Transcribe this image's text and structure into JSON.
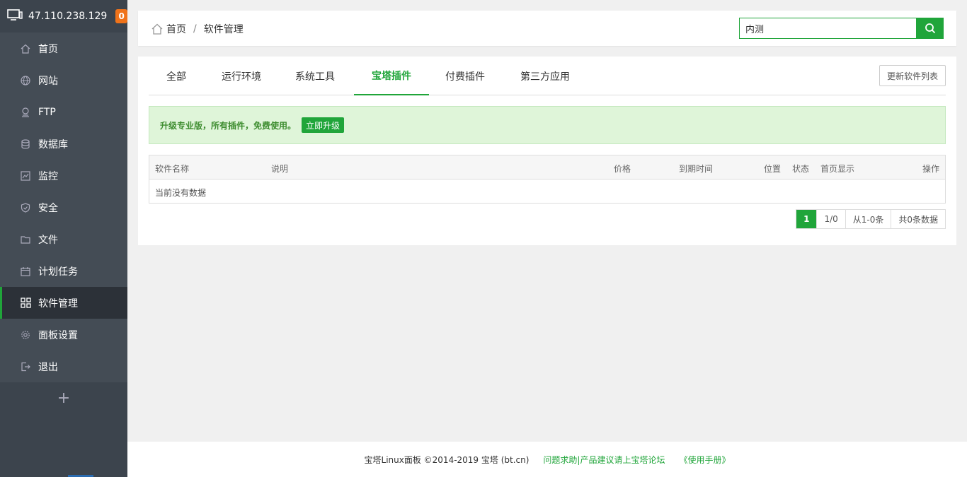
{
  "sidebar": {
    "ip": "47.110.238.129",
    "badge": "0",
    "items": [
      {
        "label": "首页",
        "icon": "home-icon"
      },
      {
        "label": "网站",
        "icon": "globe-icon"
      },
      {
        "label": "FTP",
        "icon": "ftp-icon"
      },
      {
        "label": "数据库",
        "icon": "database-icon"
      },
      {
        "label": "监控",
        "icon": "monitor-icon"
      },
      {
        "label": "安全",
        "icon": "shield-icon"
      },
      {
        "label": "文件",
        "icon": "folder-icon"
      },
      {
        "label": "计划任务",
        "icon": "calendar-icon"
      },
      {
        "label": "软件管理",
        "icon": "grid-icon"
      },
      {
        "label": "面板设置",
        "icon": "gear-icon"
      },
      {
        "label": "退出",
        "icon": "logout-icon"
      }
    ],
    "add": "+"
  },
  "header": {
    "crumb_home": "首页",
    "crumb_sep": "/",
    "crumb_current": "软件管理",
    "search_value": "内测"
  },
  "tabs": [
    "全部",
    "运行环境",
    "系统工具",
    "宝塔插件",
    "付费插件",
    "第三方应用"
  ],
  "active_tab": "宝塔插件",
  "refresh_label": "更新软件列表",
  "alert": {
    "text": "升级专业版，所有插件，免费使用。",
    "button": "立即升级"
  },
  "table": {
    "columns": [
      "软件名称",
      "说明",
      "价格",
      "到期时间",
      "位置",
      "状态",
      "首页显示",
      "操作"
    ],
    "empty": "当前没有数据"
  },
  "pager": {
    "current": "1",
    "pages": "1/0",
    "range": "从1-0条",
    "total": "共0条数据"
  },
  "footer": {
    "copyright": "宝塔Linux面板 ©2014-2019 宝塔 (bt.cn)",
    "help": "问题求助|产品建议请上宝塔论坛",
    "manual": "《使用手册》"
  },
  "colors": {
    "accent": "#20a53a",
    "sidebar": "#3c444d",
    "badge": "#f0731a"
  }
}
